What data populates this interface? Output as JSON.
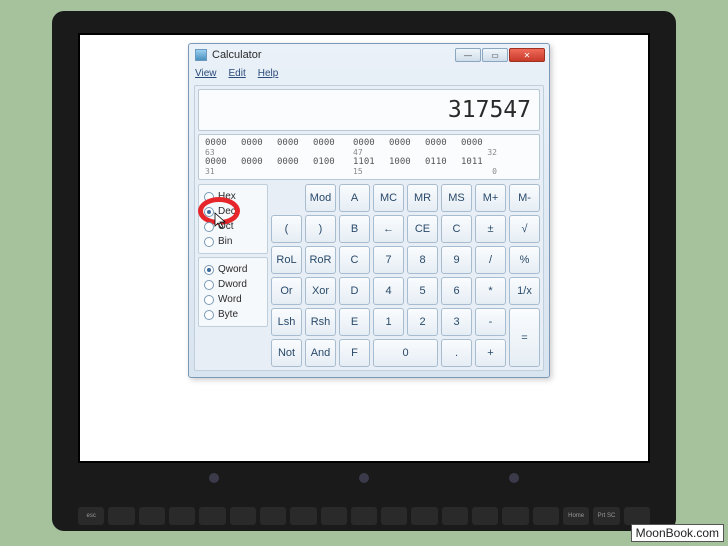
{
  "watermark": "MoonBook.com",
  "window": {
    "title": "Calculator",
    "menu": [
      "View",
      "Edit",
      "Help"
    ],
    "display": "317547",
    "bits": {
      "row1": [
        "0000",
        "0000",
        "0000",
        "0000",
        "0000",
        "0000",
        "0000",
        "0000"
      ],
      "label1_left": "63",
      "label1_mid": "47",
      "label1_right": "32",
      "row2": [
        "0000",
        "0000",
        "0000",
        "0100",
        "1101",
        "1000",
        "0110",
        "1011"
      ],
      "label2_left": "31",
      "label2_mid": "15",
      "label2_right": "0"
    },
    "base_radios": [
      {
        "label": "Hex",
        "checked": false
      },
      {
        "label": "Dec",
        "checked": true,
        "highlight": true
      },
      {
        "label": "Oct",
        "checked": false
      },
      {
        "label": "Bin",
        "checked": false
      }
    ],
    "size_radios": [
      {
        "label": "Qword",
        "checked": true
      },
      {
        "label": "Dword",
        "checked": false
      },
      {
        "label": "Word",
        "checked": false
      },
      {
        "label": "Byte",
        "checked": false
      }
    ],
    "keys": {
      "r1": [
        "",
        "Mod",
        "A",
        "MC",
        "MR",
        "MS",
        "M+",
        "M-"
      ],
      "r2": [
        "(",
        ")",
        "B",
        "←",
        "CE",
        "C",
        "±",
        "√"
      ],
      "r3": [
        "RoL",
        "RoR",
        "C",
        "7",
        "8",
        "9",
        "/",
        "%"
      ],
      "r4": [
        "Or",
        "Xor",
        "D",
        "4",
        "5",
        "6",
        "*",
        "1/x"
      ],
      "r5": [
        "Lsh",
        "Rsh",
        "E",
        "1",
        "2",
        "3",
        "-",
        "="
      ],
      "r6": [
        "Not",
        "And",
        "F",
        "0",
        ".",
        "+"
      ]
    }
  },
  "keyboard_keys": [
    "esc",
    "",
    "",
    "",
    "",
    "",
    "",
    "",
    "",
    "",
    "",
    "",
    "",
    "",
    "",
    "",
    "Home",
    "Prt SC",
    ""
  ]
}
